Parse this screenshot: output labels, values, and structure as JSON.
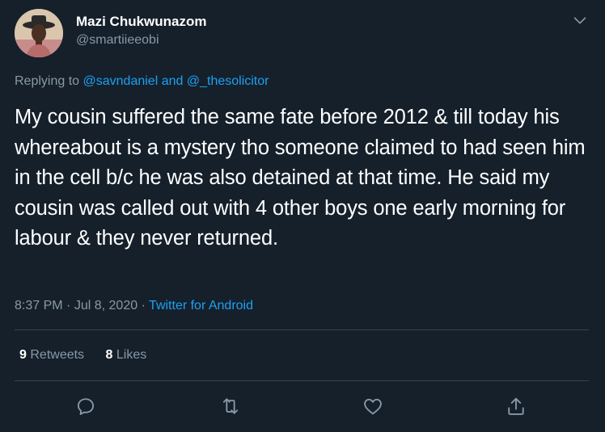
{
  "tweet": {
    "author_name": "Mazi Chukwunazom",
    "author_handle": "@smartiieeobi",
    "replying_prefix": "Replying to",
    "replying_user1": "@savndaniel",
    "replying_and": "and",
    "replying_user2": "@_thesolicitor",
    "text": "My cousin suffered the same fate before 2012 & till today his whereabout is a mystery tho someone claimed to had seen him in the cell b/c he was also detained at that time. He said my cousin was called out with 4 other boys one early morning for labour & they never returned.",
    "time": "8:37 PM",
    "separator": "·",
    "date": "Jul 8, 2020",
    "source": "Twitter for Android"
  },
  "stats": {
    "retweets_count": "9",
    "retweets_label": "Retweets",
    "likes_count": "8",
    "likes_label": "Likes"
  },
  "icons": {
    "more": "chevron-down-icon",
    "reply": "reply-icon",
    "retweet": "retweet-icon",
    "like": "heart-icon",
    "share": "share-icon"
  },
  "colors": {
    "background": "#15202b",
    "accent": "#1da1f2",
    "secondary_text": "#8899a6",
    "divider": "#38444d"
  }
}
